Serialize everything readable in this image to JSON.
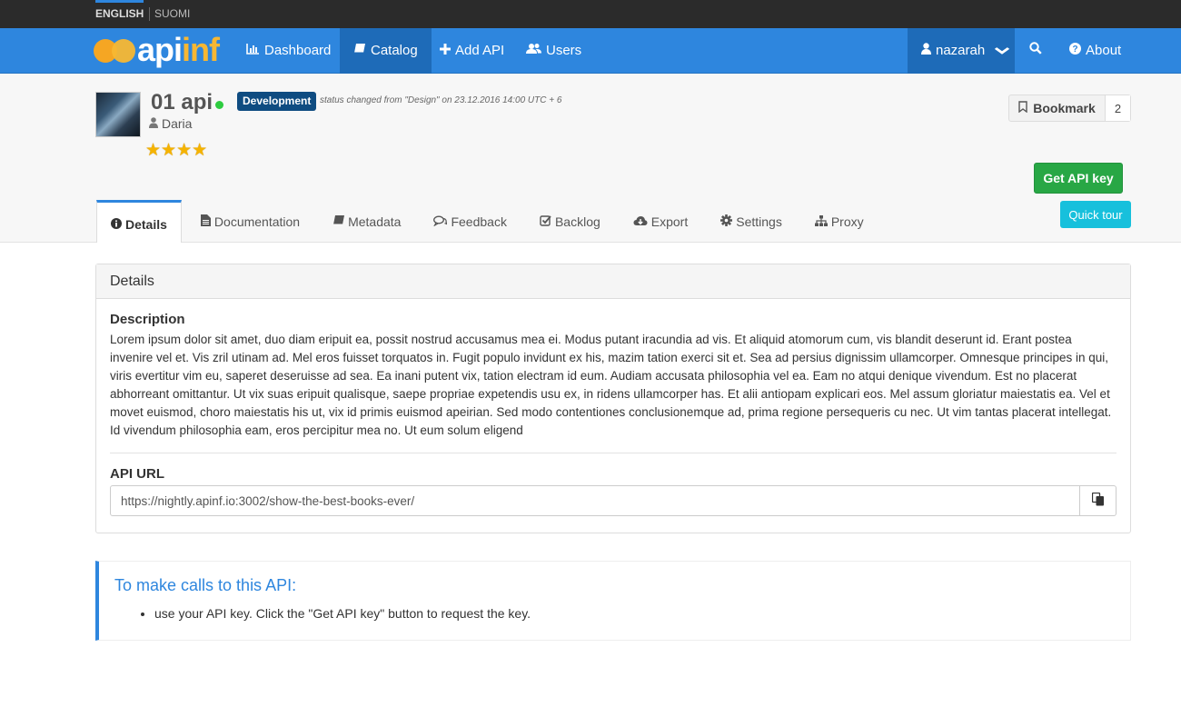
{
  "languages": {
    "english": "ENGLISH",
    "finnish": "SUOMI"
  },
  "brand": {
    "logo_main": "api",
    "logo_accent": "nf",
    "logo_i": "i"
  },
  "nav": {
    "dashboard": "Dashboard",
    "catalog": "Catalog",
    "add_api": "Add API",
    "users": "Users",
    "user": "nazarah",
    "about": "About"
  },
  "api": {
    "name": "01 api",
    "lifecycle_badge": "Development",
    "status_note": "status changed from \"Design\" on 23.12.2016 14:00 UTC + 6",
    "author": "Daria",
    "rating_stars": 4
  },
  "actions": {
    "bookmark_label": "Bookmark",
    "bookmark_count": "2",
    "get_api_key": "Get API key",
    "quick_tour": "Quick tour"
  },
  "tabs": {
    "details": "Details",
    "documentation": "Documentation",
    "metadata": "Metadata",
    "feedback": "Feedback",
    "backlog": "Backlog",
    "export": "Export",
    "settings": "Settings",
    "proxy": "Proxy"
  },
  "details": {
    "panel_title": "Details",
    "description_title": "Description",
    "description": "Lorem ipsum dolor sit amet, duo diam eripuit ea, possit nostrud accusamus mea ei. Modus putant iracundia ad vis. Et aliquid atomorum cum, vis blandit deserunt id. Erant postea invenire vel et. Vis zril utinam ad. Mel eros fuisset torquatos in. Fugit populo invidunt ex his, mazim tation exerci sit et. Sea ad persius dignissim ullamcorper. Omnesque principes in qui, viris evertitur vim eu, saperet deseruisse ad sea. Ea inani putent vix, tation electram id eum. Audiam accusata philosophia vel ea. Eam no atqui denique vivendum. Est no placerat abhorreant omittantur. Ut vix suas eripuit qualisque, saepe propriae expetendis usu ex, in ridens ullamcorper has. Et alii antiopam explicari eos. Mel assum gloriatur maiestatis ea. Vel et movet euismod, choro maiestatis his ut, vix id primis euismod apeirian. Sed modo contentiones conclusionemque ad, prima regione persequeris cu nec. Ut vim tantas placerat intellegat. Id vivendum philosophia eam, eros percipitur mea no. Ut eum solum eligend",
    "api_url_title": "API URL",
    "api_url": "https://nightly.apinf.io:3002/show-the-best-books-ever/"
  },
  "callout": {
    "title": "To make calls to this API:",
    "item": "use your API key. Click the \"Get API key\" button to request the key."
  },
  "colors": {
    "primary": "#2e86de",
    "success": "#28a745",
    "info": "#17c0dc",
    "badge": "#0f4c81",
    "online": "#2ecc40"
  }
}
